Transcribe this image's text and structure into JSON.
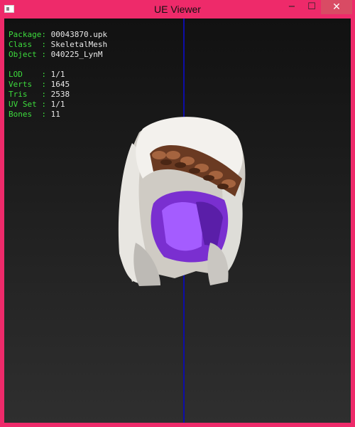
{
  "window": {
    "title": "UE Viewer",
    "controls": {
      "minimize": "−",
      "maximize": "☐",
      "close": "✕"
    }
  },
  "info": {
    "package_label": "Package:",
    "package": "00043870.upk",
    "class_label": "Class  :",
    "class": "SkeletalMesh",
    "object_label": "Object :",
    "object": "040225_LynM",
    "lod_label": "LOD    :",
    "lod": "1/1",
    "verts_label": "Verts  :",
    "verts": "1645",
    "tris_label": "Tris   :",
    "tris": "2538",
    "uvset_label": "UV Set :",
    "uvset": "1/1",
    "bones_label": "Bones  :",
    "bones": "11"
  },
  "colors": {
    "frame": "#ee2a6a",
    "label": "#3ddc3d",
    "value": "#e8e8e8",
    "axis": "#0d0da8"
  }
}
